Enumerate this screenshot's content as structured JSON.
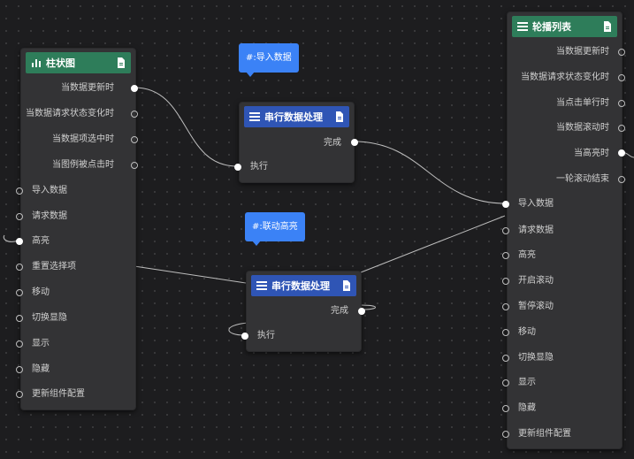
{
  "nodes": {
    "bar_chart": {
      "title": "柱状图",
      "outputs": [
        "当数据更新时",
        "当数据请求状态变化时",
        "当数据项选中时",
        "当图例被点击时"
      ],
      "inputs": [
        "导入数据",
        "请求数据",
        "高亮",
        "重置选择项",
        "移动",
        "切换显隐",
        "显示",
        "隐藏",
        "更新组件配置"
      ]
    },
    "serial_1": {
      "title": "串行数据处理",
      "output": "完成",
      "input": "执行"
    },
    "serial_2": {
      "title": "串行数据处理",
      "output": "完成",
      "input": "执行"
    },
    "carousel": {
      "title": "轮播列表",
      "outputs": [
        "当数据更新时",
        "当数据请求状态变化时",
        "当点击单行时",
        "当数据滚动时",
        "当高亮时",
        "一轮滚动结束"
      ],
      "inputs": [
        "导入数据",
        "请求数据",
        "高亮",
        "开启滚动",
        "暂停滚动",
        "移动",
        "切换显隐",
        "显示",
        "隐藏",
        "更新组件配置"
      ]
    }
  },
  "tags": {
    "import": "#:导入数据",
    "linkage": "#:联动高亮"
  },
  "colors": {
    "canvas": "#1d1d1f",
    "node": "#333335",
    "header_green": "#2e7d5a",
    "header_blue": "#2f55b5",
    "tag": "#3b82f6",
    "wire": "#bdbdbd"
  }
}
